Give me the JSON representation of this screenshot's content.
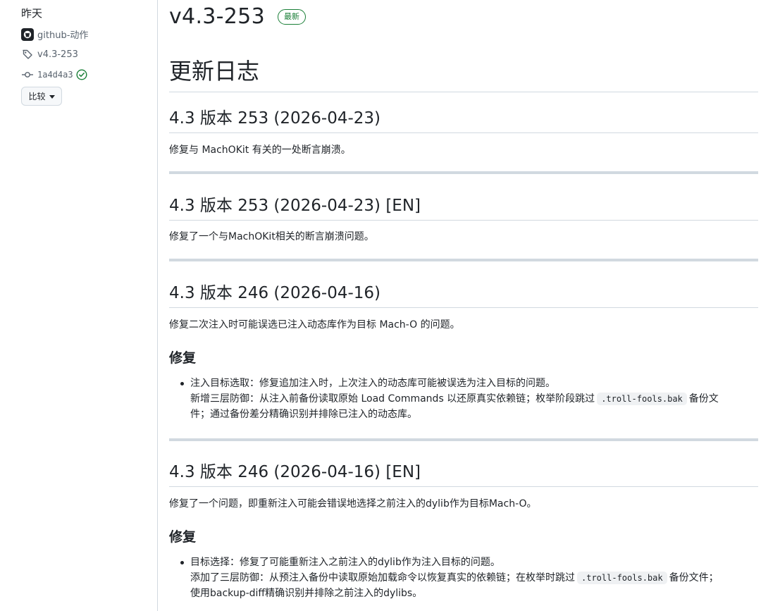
{
  "sidebar": {
    "date": "昨天",
    "author": "github-动作",
    "tag": "v4.3-253",
    "commit": "1a4d4a3",
    "compare_label": "比较"
  },
  "release": {
    "title": "v4.3-253",
    "badge": "最新"
  },
  "changelog": {
    "heading": "更新日志",
    "sections": [
      {
        "title": "4.3 版本 253 (2026-04-23)",
        "para": "修复与 MachOKit 有关的一处断言崩溃。"
      },
      {
        "title": "4.3 版本 253 (2026-04-23) [EN]",
        "para": "修复了一个与MachOKit相关的断言崩溃问题。"
      },
      {
        "title": "4.3 版本 246 (2026-04-16)",
        "para": "修复二次注入时可能误选已注入动态库作为目标 Mach-O 的问题。",
        "subheading": "修复",
        "bullet": {
          "line1": "注入目标选取：修复追加注入时，上次注入的动态库可能被误选为注入目标的问题。",
          "line2_a": "新增三层防御：从注入前备份读取原始 Load Commands 以还原真实依赖链；枚举阶段跳过",
          "code": ".troll-fools.bak",
          "line2_b": "备份文",
          "line3": "件；通过备份差分精确识别并排除已注入的动态库。"
        }
      },
      {
        "title": "4.3 版本 246 (2026-04-16) [EN]",
        "para": "修复了一个问题，即重新注入可能会错误地选择之前注入的dylib作为目标Mach-O。",
        "subheading": "修复",
        "bullet": {
          "line1": "目标选择：修复了可能重新注入之前注入的dylib作为注入目标的问题。",
          "line2_a": "添加了三层防御：从预注入备份中读取原始加载命令以恢复真实的依赖链；在枚举时跳过",
          "code": ".troll-fools.bak",
          "line2_b": "备份文件；",
          "line3": "使用backup-diff精确识别并排除之前注入的dylibs。"
        }
      }
    ]
  },
  "colors": {
    "accent_green": "#1a7f37",
    "border": "#d1d9e0",
    "text": "#1f2328",
    "muted": "#59636e"
  },
  "icons": [
    "github-icon",
    "tag-icon",
    "commit-icon",
    "check-circle-icon",
    "caret-down-icon"
  ]
}
